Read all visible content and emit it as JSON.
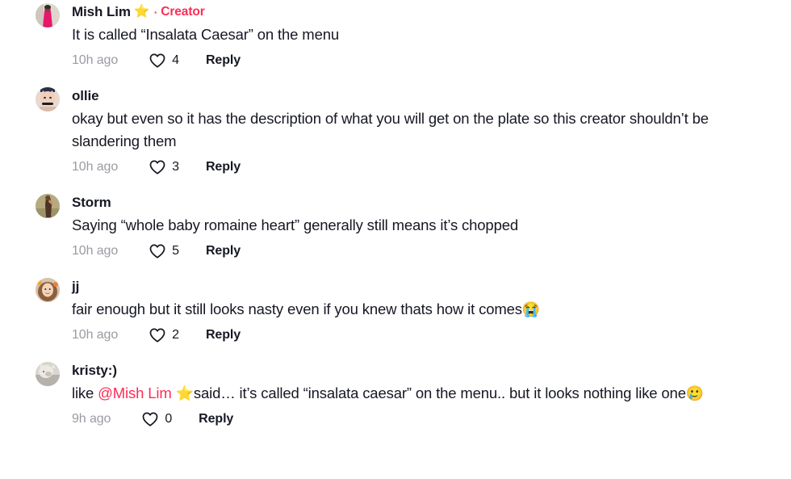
{
  "app": "tiktok-comments",
  "colors": {
    "accent": "#fe2c55",
    "text": "#161823",
    "muted": "#9b9ba4",
    "background": "#ffffff"
  },
  "labels": {
    "reply": "Reply",
    "creator_badge": "Creator",
    "separator": "·",
    "heart_icon": "heart-outline-icon"
  },
  "comments": [
    {
      "author": "Mish Lim",
      "author_emoji": "⭐",
      "is_creator": true,
      "text_parts": [
        {
          "type": "text",
          "value": "It is called “Insalata Caesar” on the menu"
        }
      ],
      "timestamp": "10h ago",
      "likes": "4",
      "reply": "Reply",
      "avatar_name": "avatar-mish-lim"
    },
    {
      "author": "ollie",
      "author_emoji": "",
      "is_creator": false,
      "text_parts": [
        {
          "type": "text",
          "value": "okay but even so it has the description of what you will get on the plate so this creator shouldn’t be slandering them"
        }
      ],
      "timestamp": "10h ago",
      "likes": "3",
      "reply": "Reply",
      "avatar_name": "avatar-ollie"
    },
    {
      "author": "Storm",
      "author_emoji": "",
      "is_creator": false,
      "text_parts": [
        {
          "type": "text",
          "value": "Saying “whole baby romaine heart” generally still means it’s chopped"
        }
      ],
      "timestamp": "10h ago",
      "likes": "5",
      "reply": "Reply",
      "avatar_name": "avatar-storm"
    },
    {
      "author": "jj",
      "author_emoji": "",
      "is_creator": false,
      "text_parts": [
        {
          "type": "text",
          "value": "fair enough but it still looks nasty even if you knew thats how it comes"
        },
        {
          "type": "emoji",
          "value": "😭"
        }
      ],
      "timestamp": "10h ago",
      "likes": "2",
      "reply": "Reply",
      "avatar_name": "avatar-jj"
    },
    {
      "author": "kristy:)",
      "author_emoji": "",
      "is_creator": false,
      "text_parts": [
        {
          "type": "text",
          "value": "like "
        },
        {
          "type": "mention",
          "value": "@Mish Lim"
        },
        {
          "type": "text",
          "value": " "
        },
        {
          "type": "emoji",
          "value": "⭐"
        },
        {
          "type": "text",
          "value": "said… it’s called “insalata caesar” on the menu.. but it looks nothing like one"
        },
        {
          "type": "emoji",
          "value": "🥲"
        }
      ],
      "timestamp": "9h ago",
      "likes": "0",
      "reply": "Reply",
      "avatar_name": "avatar-kristy"
    }
  ]
}
